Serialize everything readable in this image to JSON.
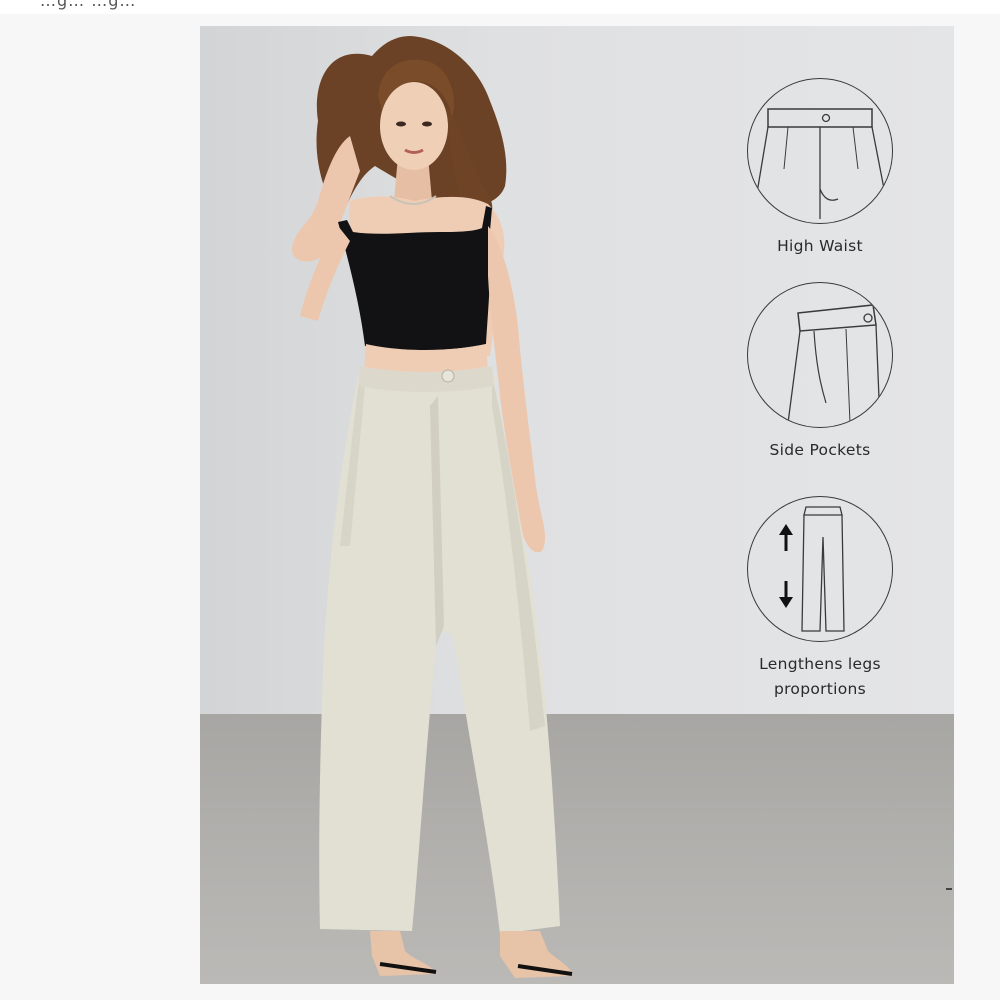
{
  "top_strip_text": "…g…   …g…",
  "product_image": {
    "name": "wide-leg trousers model photo",
    "features": [
      {
        "label": "High Waist",
        "icon": "high-waist-icon"
      },
      {
        "label": "Side Pockets",
        "icon": "side-pockets-icon"
      },
      {
        "label": "Lengthens legs proportions",
        "line1": "Lengthens legs",
        "line2": "proportions",
        "icon": "lengthens-legs-icon"
      }
    ]
  },
  "colors": {
    "wall": "#dfe0e2",
    "floor": "#b3b2af",
    "trousers": "#e2dfd3",
    "top": "#121214",
    "icon_stroke": "#3a3a3a"
  }
}
